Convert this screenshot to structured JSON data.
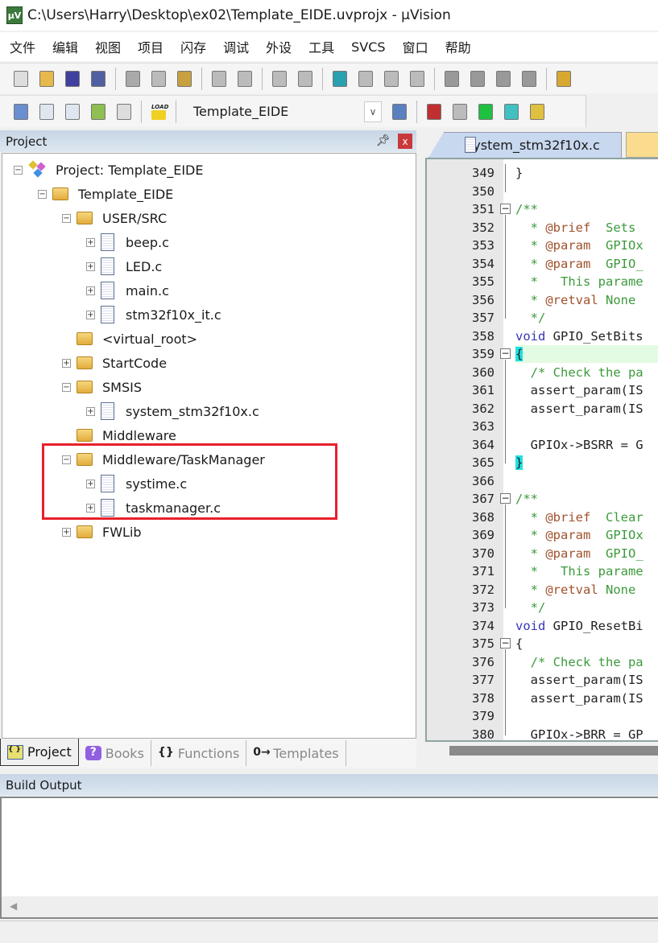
{
  "window": {
    "title": "C:\\Users\\Harry\\Desktop\\ex02\\Template_EIDE.uvprojx - µVision",
    "app_icon": "µV"
  },
  "menu": [
    "文件",
    "编辑",
    "视图",
    "项目",
    "闪存",
    "调试",
    "外设",
    "工具",
    "SVCS",
    "窗口",
    "帮助"
  ],
  "toolbar1": [
    "new-file-icon",
    "open-file-icon",
    "save-icon",
    "save-all-icon",
    "cut-icon",
    "copy-icon",
    "paste-icon",
    "undo-icon",
    "redo-icon",
    "nav-back-icon",
    "nav-forward-icon",
    "bookmark-icon",
    "prev-bookmark-icon",
    "next-bookmark-icon",
    "clear-bookmarks-icon",
    "indent-icon",
    "unindent-icon",
    "comment-icon",
    "uncomment-icon",
    "find-in-files-icon"
  ],
  "toolbar2": {
    "target": "Template_EIDE",
    "icons": [
      "translate-icon",
      "build-icon",
      "rebuild-icon",
      "batch-build-icon",
      "stop-build-icon",
      "download-icon",
      "options-icon",
      "manage-components-icon",
      "select-packs-icon",
      "pack-installer-icon",
      "event-recorder-icon",
      "layers-icon"
    ],
    "load_label": "LOAD"
  },
  "project_pane": {
    "title": "Project",
    "tree": [
      {
        "label": "Project: Template_EIDE",
        "level": 0,
        "type": "project",
        "expander": "−"
      },
      {
        "label": "Template_EIDE",
        "level": 1,
        "type": "target",
        "expander": "−"
      },
      {
        "label": "USER/SRC",
        "level": 2,
        "type": "folder",
        "expander": "−"
      },
      {
        "label": "beep.c",
        "level": 3,
        "type": "file",
        "expander": "+"
      },
      {
        "label": "LED.c",
        "level": 3,
        "type": "file",
        "expander": "+"
      },
      {
        "label": "main.c",
        "level": 3,
        "type": "file",
        "expander": "+"
      },
      {
        "label": "stm32f10x_it.c",
        "level": 3,
        "type": "file",
        "expander": "+"
      },
      {
        "label": "<virtual_root>",
        "level": 2,
        "type": "folder",
        "expander": ""
      },
      {
        "label": "StartCode",
        "level": 2,
        "type": "folder",
        "expander": "+"
      },
      {
        "label": "SMSIS",
        "level": 2,
        "type": "folder",
        "expander": "−"
      },
      {
        "label": "system_stm32f10x.c",
        "level": 3,
        "type": "file",
        "expander": "+"
      },
      {
        "label": "Middleware",
        "level": 2,
        "type": "folder",
        "expander": ""
      },
      {
        "label": "Middleware/TaskManager",
        "level": 2,
        "type": "folder",
        "expander": "−"
      },
      {
        "label": "systime.c",
        "level": 3,
        "type": "file",
        "expander": "+"
      },
      {
        "label": "taskmanager.c",
        "level": 3,
        "type": "file",
        "expander": "+"
      },
      {
        "label": "FWLib",
        "level": 2,
        "type": "folder",
        "expander": "+"
      }
    ],
    "tabs": [
      {
        "label": "Project",
        "icon": "{ }",
        "active": true
      },
      {
        "label": "Books",
        "icon": "?",
        "active": false
      },
      {
        "label": "Functions",
        "icon": "{}",
        "active": false
      },
      {
        "label": "Templates",
        "icon": "0→",
        "active": false
      }
    ]
  },
  "editor": {
    "active_tab": "system_stm32f10x.c",
    "lines": [
      {
        "n": "349",
        "s": [
          [
            "}",
            "tx"
          ]
        ]
      },
      {
        "n": "350",
        "s": []
      },
      {
        "n": "351",
        "fold": true,
        "s": [
          [
            "/**",
            "cm"
          ]
        ]
      },
      {
        "n": "352",
        "s": [
          [
            "  * ",
            "cm"
          ],
          [
            "@brief",
            "tg"
          ],
          [
            "  Sets",
            "cm"
          ]
        ]
      },
      {
        "n": "353",
        "s": [
          [
            "  * ",
            "cm"
          ],
          [
            "@param",
            "tg"
          ],
          [
            "  GPIOx",
            "cm"
          ]
        ]
      },
      {
        "n": "354",
        "s": [
          [
            "  * ",
            "cm"
          ],
          [
            "@param",
            "tg"
          ],
          [
            "  GPIO_",
            "cm"
          ]
        ]
      },
      {
        "n": "355",
        "s": [
          [
            "  *   This parame",
            "cm"
          ]
        ]
      },
      {
        "n": "356",
        "s": [
          [
            "  * ",
            "cm"
          ],
          [
            "@retval",
            "tg"
          ],
          [
            " None",
            "cm"
          ]
        ]
      },
      {
        "n": "357",
        "s": [
          [
            "  */",
            "cm"
          ]
        ]
      },
      {
        "n": "358",
        "s": [
          [
            "void",
            "kw"
          ],
          [
            " GPIO_SetBits",
            "tx"
          ]
        ]
      },
      {
        "n": "359",
        "fold": true,
        "hl": true,
        "s": [
          [
            "{",
            "brace"
          ]
        ]
      },
      {
        "n": "360",
        "s": [
          [
            "  /* Check the pa",
            "cm"
          ]
        ]
      },
      {
        "n": "361",
        "s": [
          [
            "  assert_param(IS",
            "tx"
          ]
        ]
      },
      {
        "n": "362",
        "s": [
          [
            "  assert_param(IS",
            "tx"
          ]
        ]
      },
      {
        "n": "363",
        "s": []
      },
      {
        "n": "364",
        "s": [
          [
            "  GPIOx->BSRR = G",
            "tx"
          ]
        ]
      },
      {
        "n": "365",
        "s": [
          [
            "}",
            "brace"
          ]
        ]
      },
      {
        "n": "366",
        "s": []
      },
      {
        "n": "367",
        "fold": true,
        "s": [
          [
            "/**",
            "cm"
          ]
        ]
      },
      {
        "n": "368",
        "s": [
          [
            "  * ",
            "cm"
          ],
          [
            "@brief",
            "tg"
          ],
          [
            "  Clear",
            "cm"
          ]
        ]
      },
      {
        "n": "369",
        "s": [
          [
            "  * ",
            "cm"
          ],
          [
            "@param",
            "tg"
          ],
          [
            "  GPIOx",
            "cm"
          ]
        ]
      },
      {
        "n": "370",
        "s": [
          [
            "  * ",
            "cm"
          ],
          [
            "@param",
            "tg"
          ],
          [
            "  GPIO_",
            "cm"
          ]
        ]
      },
      {
        "n": "371",
        "s": [
          [
            "  *   This parame",
            "cm"
          ]
        ]
      },
      {
        "n": "372",
        "s": [
          [
            "  * ",
            "cm"
          ],
          [
            "@retval",
            "tg"
          ],
          [
            " None",
            "cm"
          ]
        ]
      },
      {
        "n": "373",
        "s": [
          [
            "  */",
            "cm"
          ]
        ]
      },
      {
        "n": "374",
        "s": [
          [
            "void",
            "kw"
          ],
          [
            " GPIO_ResetBi",
            "tx"
          ]
        ]
      },
      {
        "n": "375",
        "fold": true,
        "s": [
          [
            "{",
            "tx"
          ]
        ]
      },
      {
        "n": "376",
        "s": [
          [
            "  /* Check the pa",
            "cm"
          ]
        ]
      },
      {
        "n": "377",
        "s": [
          [
            "  assert_param(IS",
            "tx"
          ]
        ]
      },
      {
        "n": "378",
        "s": [
          [
            "  assert_param(IS",
            "tx"
          ]
        ]
      },
      {
        "n": "379",
        "s": []
      },
      {
        "n": "380",
        "s": [
          [
            "  GPIOx->BRR = GP",
            "tx"
          ]
        ]
      }
    ]
  },
  "build_output": {
    "title": "Build Output"
  },
  "colors": {
    "highlight_box": "#e8202a",
    "pane_header": "#c7d5e5",
    "comment": "#3c9a3c",
    "keyword": "#3636b8",
    "doc_tag": "#a0522d"
  }
}
